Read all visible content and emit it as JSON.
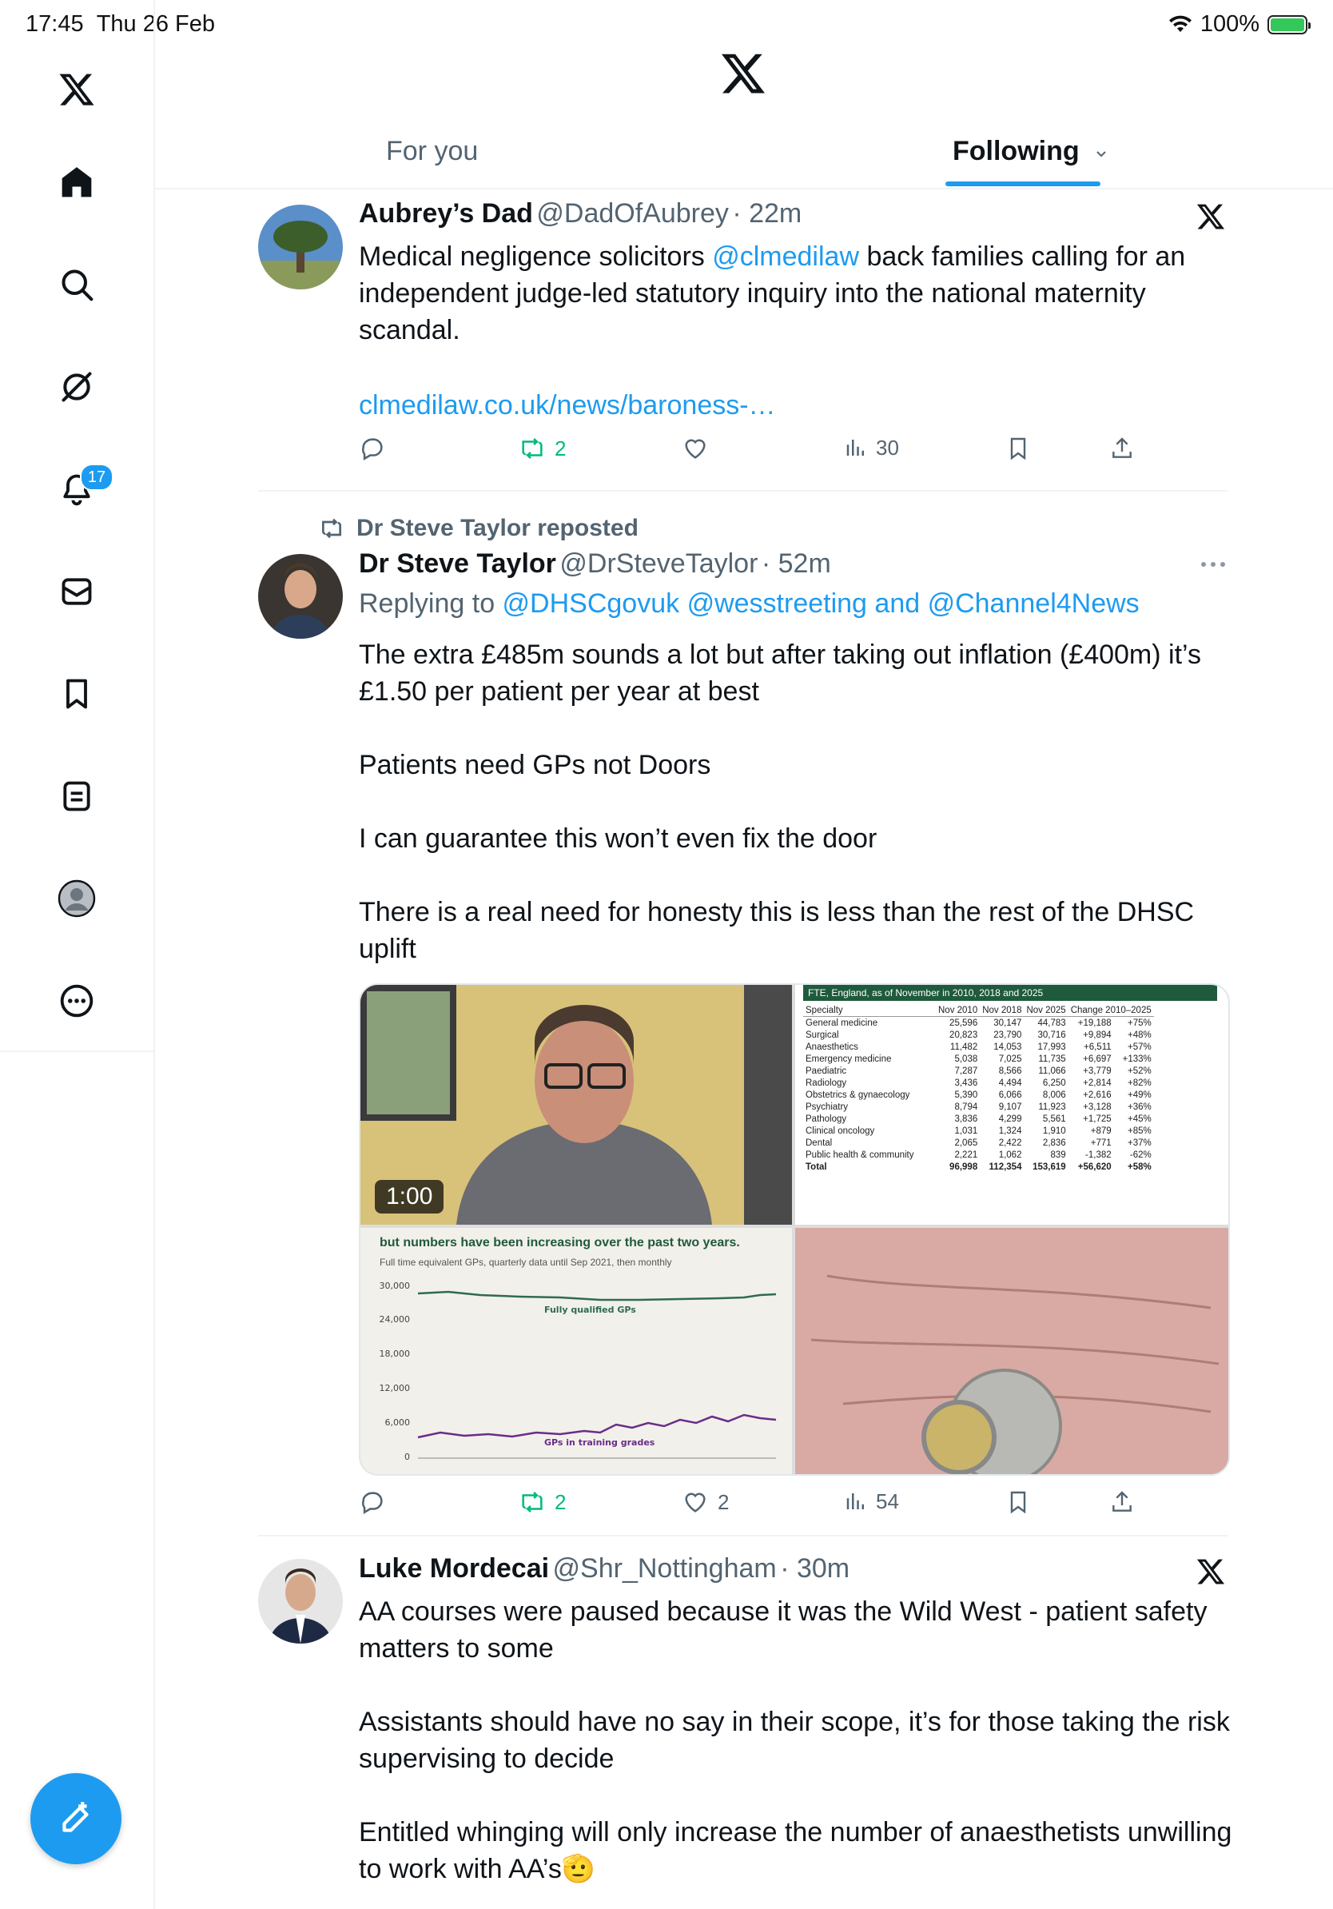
{
  "status_bar": {
    "time": "17:45",
    "date": "Thu 26 Feb",
    "battery": "100%"
  },
  "sidebar": {
    "items": [
      {
        "icon": "home-icon"
      },
      {
        "icon": "search-icon"
      },
      {
        "icon": "grok-icon"
      },
      {
        "icon": "notifications-icon",
        "badge": "17"
      },
      {
        "icon": "messages-icon"
      },
      {
        "icon": "bookmarks-icon"
      },
      {
        "icon": "lists-icon"
      },
      {
        "icon": "profile-icon"
      },
      {
        "icon": "more-icon"
      }
    ]
  },
  "header": {
    "tab_for_you": "For you",
    "tab_following": "Following"
  },
  "colors": {
    "accent": "#1d9bf0",
    "repost_green": "#00ba7c",
    "secondary_text": "#536471"
  },
  "tweets": [
    {
      "name": "Aubrey’s Dad",
      "handle": "@DadOfAubrey",
      "time": "· 22m",
      "text_pre": "Medical negligence solicitors ",
      "mention": "@clmedilaw",
      "text_post": " back families calling for an independent judge-led statutory inquiry into the national maternity scandal.",
      "link": "clmedilaw.co.uk/news/baroness-…",
      "reposts": "2",
      "views": "30"
    },
    {
      "repost_label": "Dr Steve Taylor reposted",
      "name": "Dr Steve Taylor",
      "handle": "@DrSteveTaylor",
      "time": "· 52m",
      "replying_prefix": "Replying to ",
      "replying_to": "@DHSCgovuk @wesstreeting and @Channel4News",
      "paragraphs": [
        "The extra £485m sounds a lot but after taking out inflation (£400m) it’s £1.50 per patient per year at best",
        "Patients need GPs not Doors",
        "I can guarantee this won’t even fix the door",
        "There is a real need for honesty this is less than the rest of the DHSC uplift"
      ],
      "video_duration": "1:00",
      "reposts": "2",
      "likes": "2",
      "views": "54"
    },
    {
      "name": "Luke Mordecai",
      "handle": "@Shr_Nottingham",
      "time": "· 30m",
      "paragraphs": [
        "AA courses were paused because it was the Wild West - patient safety matters to some",
        "Assistants should have no say in their scope, it’s for those taking the risk supervising to decide",
        "Entitled whinging will only increase the number of anaesthetists unwilling to work with AA’s🫡"
      ]
    }
  ],
  "table_image": {
    "title": "FTE, England, as of November in 2010, 2018 and 2025",
    "headers": [
      "Specialty",
      "Nov 2010",
      "Nov 2018",
      "Nov 2025",
      "Change 2010–2025",
      ""
    ],
    "rows": [
      [
        "General medicine",
        "25,596",
        "30,147",
        "44,783",
        "+19,188",
        "+75%"
      ],
      [
        "Surgical",
        "20,823",
        "23,790",
        "30,716",
        "+9,894",
        "+48%"
      ],
      [
        "Anaesthetics",
        "11,482",
        "14,053",
        "17,993",
        "+6,511",
        "+57%"
      ],
      [
        "Emergency medicine",
        "5,038",
        "7,025",
        "11,735",
        "+6,697",
        "+133%"
      ],
      [
        "Paediatric",
        "7,287",
        "8,566",
        "11,066",
        "+3,779",
        "+52%"
      ],
      [
        "Radiology",
        "3,436",
        "4,494",
        "6,250",
        "+2,814",
        "+82%"
      ],
      [
        "Obstetrics & gynaecology",
        "5,390",
        "6,066",
        "8,006",
        "+2,616",
        "+49%"
      ],
      [
        "Psychiatry",
        "8,794",
        "9,107",
        "11,923",
        "+3,128",
        "+36%"
      ],
      [
        "Pathology",
        "3,836",
        "4,299",
        "5,561",
        "+1,725",
        "+45%"
      ],
      [
        "Clinical oncology",
        "1,031",
        "1,324",
        "1,910",
        "+879",
        "+85%"
      ],
      [
        "Dental",
        "2,065",
        "2,422",
        "2,836",
        "+771",
        "+37%"
      ],
      [
        "Public health & community",
        "2,221",
        "1,062",
        "839",
        "-1,382",
        "-62%"
      ],
      [
        "Total",
        "96,998",
        "112,354",
        "153,619",
        "+56,620",
        "+58%"
      ]
    ]
  },
  "chart_image": {
    "title": "but numbers have been increasing over the past two years.",
    "subtitle": "Full time equivalent GPs, quarterly data until Sep 2021, then monthly",
    "y_ticks": [
      "30,000",
      "24,000",
      "18,000",
      "12,000",
      "6,000",
      "0"
    ],
    "series_labels": [
      "Fully qualified GPs",
      "GPs in training grades"
    ]
  }
}
